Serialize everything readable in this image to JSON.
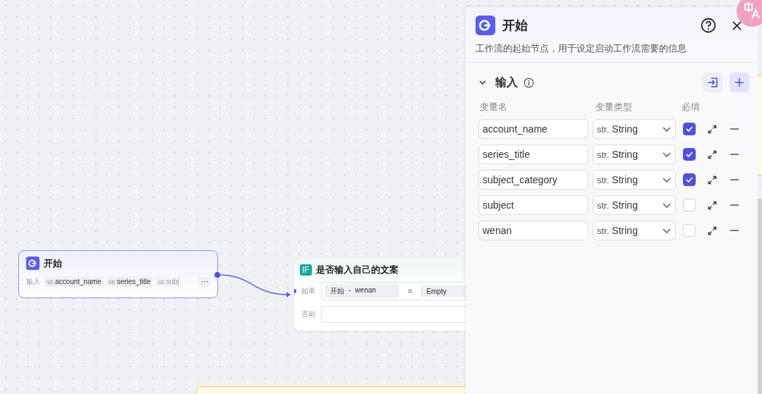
{
  "start_node": {
    "title": "开始",
    "input_label": "输入",
    "more": "···",
    "params": [
      {
        "type": "str.",
        "name": "account_name",
        "faded": false
      },
      {
        "type": "str.",
        "name": "series_title",
        "faded": false
      },
      {
        "type": "str.",
        "name": "subj",
        "faded": true
      }
    ]
  },
  "condition_node": {
    "badge": "IF",
    "title": "是否输入自己的文案",
    "if_label": "如果",
    "source": "开始",
    "separator": "-",
    "variable": "wenan",
    "operator": "=",
    "value": "Empty",
    "else_label": "否则"
  },
  "panel": {
    "title": "开始",
    "description": "工作流的起始节点，用于设定启动工作流需要的信息",
    "section": {
      "title": "输入",
      "expanded": true
    },
    "columns": [
      "变量名",
      "变量类型",
      "必填"
    ],
    "variables": [
      {
        "name": "account_name",
        "type_prefix": "str.",
        "type": "String",
        "required": true
      },
      {
        "name": "series_title",
        "type_prefix": "str.",
        "type": "String",
        "required": true
      },
      {
        "name": "subject_category",
        "type_prefix": "str.",
        "type": "String",
        "required": true
      },
      {
        "name": "subject",
        "type_prefix": "str.",
        "type": "String",
        "required": false
      },
      {
        "name": "wenan",
        "type_prefix": "str.",
        "type": "String",
        "required": false
      }
    ]
  }
}
